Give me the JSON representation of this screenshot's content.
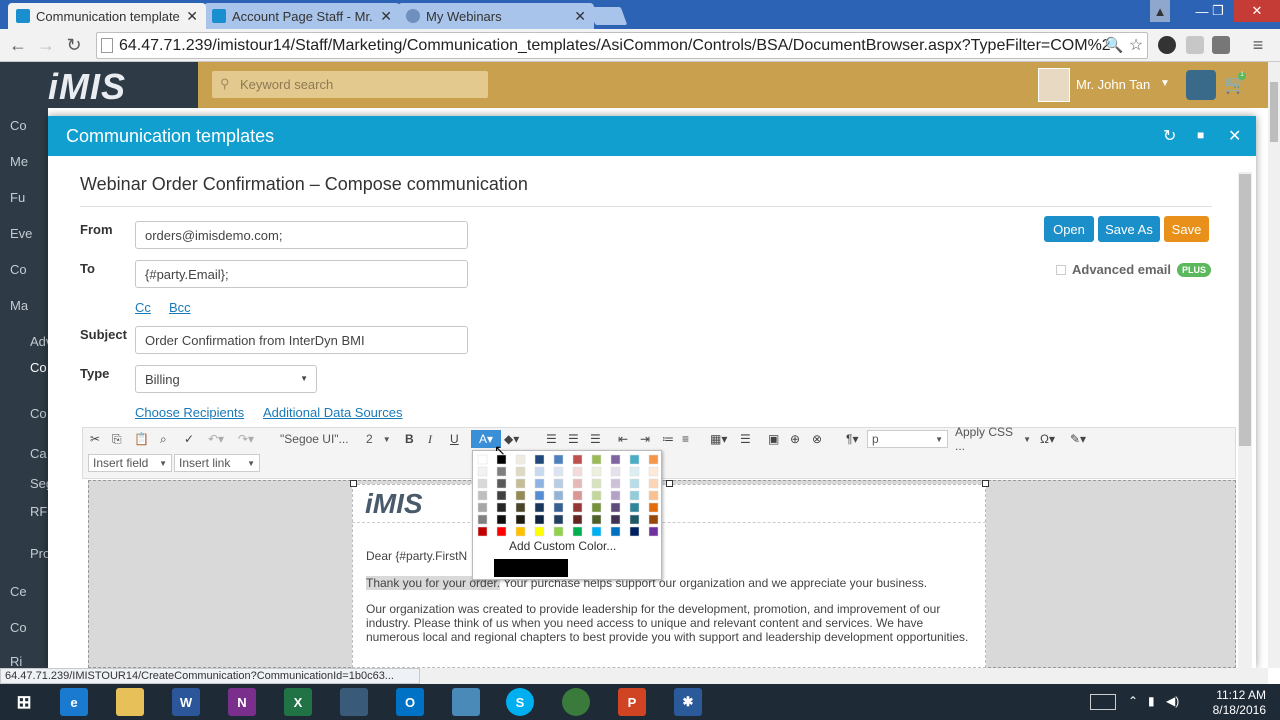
{
  "browser": {
    "tabs": [
      {
        "title": "Communication template",
        "icon": "imis-favicon",
        "active": true
      },
      {
        "title": "Account Page Staff - Mr.",
        "icon": "imis-favicon",
        "active": false
      },
      {
        "title": "My Webinars",
        "icon": "webinar-favicon",
        "active": false
      }
    ],
    "url": "64.47.71.239/imistour14/Staff/Marketing/Communication_templates/AsiCommon/Controls/BSA/DocumentBrowser.aspx?TypeFilter=COM%2"
  },
  "app": {
    "logo": "iMIS",
    "search_placeholder": "Keyword search",
    "user_name": "Mr. John Tan",
    "cart_count": "1",
    "sidebar": [
      "Co",
      "Me",
      "Fu",
      "Eve",
      "Co",
      "Ma",
      "Adv",
      "Co te",
      "Co",
      "Ca",
      "Seg",
      "RFM",
      "Pro",
      "Ce",
      "Co",
      "Ri"
    ]
  },
  "modal": {
    "title": "Communication templates",
    "compose_title": "Webinar Order Confirmation – Compose communication",
    "from_label": "From",
    "from_value": "orders@imisdemo.com;",
    "to_label": "To",
    "to_value": "{#party.Email};",
    "cc_label": "Cc",
    "bcc_label": "Bcc",
    "subject_label": "Subject",
    "subject_value": "Order Confirmation from InterDyn BMI",
    "type_label": "Type",
    "type_value": "Billing",
    "choose_recipients": "Choose Recipients",
    "additional_sources": "Additional Data Sources",
    "open_label": "Open",
    "save_as_label": "Save As",
    "save_label": "Save",
    "advanced_email_label": "Advanced email",
    "plus_badge": "PLUS",
    "colors": {
      "header": "#119fd0",
      "open": "#1a8fc9",
      "save": "#e8901a",
      "plus": "#5cb85c"
    }
  },
  "editor": {
    "font_name": "\"Segoe UI\"...",
    "font_size": "2",
    "paragraph": "p",
    "apply_css": "Apply CSS ...",
    "insert_field": "Insert field",
    "insert_link": "Insert link",
    "add_custom_color": "Add Custom Color...",
    "logo": "iMIS",
    "greeting": "Dear {#party.FirstN",
    "para1_highlight": "Thank you for your order.",
    "para1_rest": " Your purchase helps support our organization and we appreciate your business.",
    "para2": "Our organization was created to provide leadership for the development, promotion, and improvement of our industry. Please think of us when you need access to unique and relevant content and services. We have numerous local and regional chapters to best provide you with support and leadership development opportunities."
  },
  "status_url": "64.47.71.239/IMISTOUR14/CreateCommunication?CommunicationId=1b0c63...",
  "taskbar": {
    "time": "11:12 AM",
    "date": "8/18/2016"
  }
}
